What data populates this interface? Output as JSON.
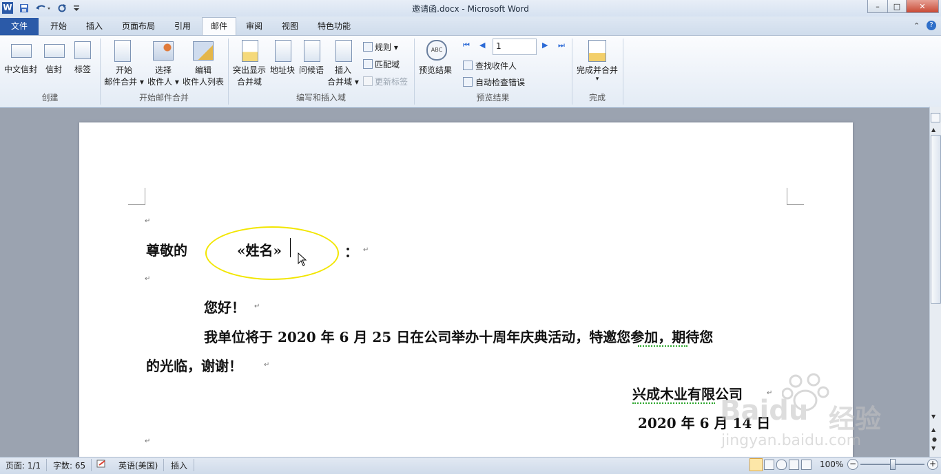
{
  "window": {
    "title": "邀请函.docx - Microsoft Word",
    "app_icon": "W",
    "controls": {
      "minimize": "–",
      "maximize": "□",
      "close": "✕"
    }
  },
  "tabs": [
    {
      "label": "文件"
    },
    {
      "label": "开始"
    },
    {
      "label": "插入"
    },
    {
      "label": "页面布局"
    },
    {
      "label": "引用"
    },
    {
      "label": "邮件"
    },
    {
      "label": "审阅"
    },
    {
      "label": "视图"
    },
    {
      "label": "特色功能"
    }
  ],
  "ribbon": {
    "groups": {
      "create": "创建",
      "start_merge": "开始邮件合并",
      "write_insert": "编写和插入域",
      "preview": "预览结果",
      "finish": "完成"
    },
    "create": {
      "chinese_envelope": "中文信封",
      "envelope": "信封",
      "labels": "标签"
    },
    "start_merge": {
      "start_l1": "开始",
      "start_l2": "邮件合并 ▾",
      "select_l1": "选择",
      "select_l2": "收件人 ▾",
      "edit_l1": "编辑",
      "edit_l2": "收件人列表"
    },
    "write_insert": {
      "highlight_l1": "突出显示",
      "highlight_l2": "合并域",
      "address_block": "地址块",
      "greeting": "问候语",
      "insert_l1": "插入",
      "insert_l2": "合并域 ▾",
      "rules": "规则 ▾",
      "match_fields": "匹配域",
      "update_labels": "更新标签"
    },
    "preview": {
      "preview_results": "预览结果",
      "record_value": "1",
      "find_recipient": "查找收件人",
      "auto_check": "自动检查错误"
    },
    "finish": {
      "finish_merge": "完成并合并",
      "arrow": "▾"
    }
  },
  "document": {
    "salutation": "尊敬的",
    "merge_field": "«姓名»",
    "colon": "：",
    "greeting": "您好！",
    "body_line1": "我单位将于 2020 年 6 月 25 日在公司举办十周年庆典活动，特邀您参加，期待您",
    "body_line2": "的光临，谢谢！",
    "company": "兴成木业有限公司",
    "date": "2020 年 6 月 14 日",
    "para_mark": "↵"
  },
  "status_bar": {
    "page": "页面: 1/1",
    "words": "字数: 65",
    "language": "英语(美国)",
    "mode": "插入",
    "zoom": "100%"
  },
  "watermark": {
    "brand": "Baidu",
    "brand_cn": "经验",
    "url": "jingyan.baidu.com"
  },
  "colors": {
    "file_tab": "#2b5aa8",
    "highlight_ellipse": "#f2e600",
    "spell_underline": "#2aa52a"
  }
}
